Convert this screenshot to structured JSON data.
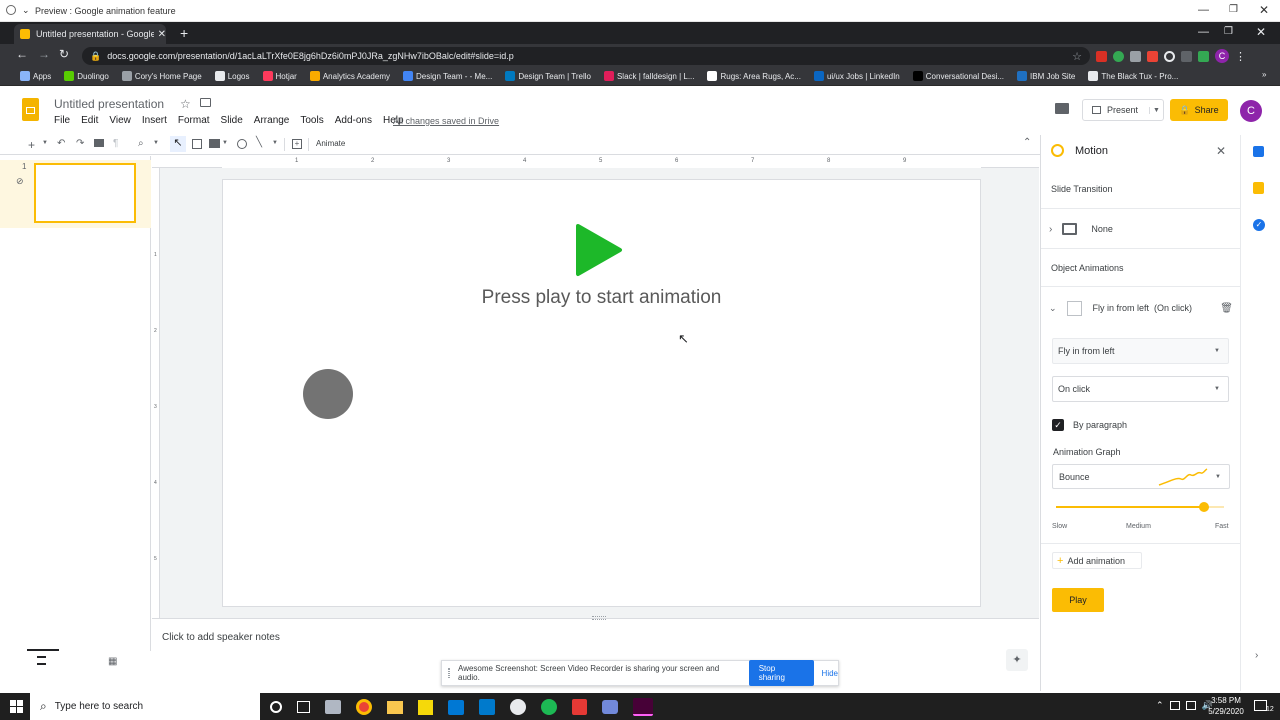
{
  "window": {
    "title": "Preview : Google animation feature"
  },
  "browser": {
    "tab_title": "Untitled presentation - Google S",
    "url": "docs.google.com/presentation/d/1acLaLTrXfe0E8jg6hDz6i0mPJ0JRa_zgNHw7ibOBalc/edit#slide=id.p",
    "profile_initial": "C",
    "bookmarks": [
      {
        "label": "Apps",
        "color": "#8ab4f8"
      },
      {
        "label": "Duolingo",
        "color": "#58cc02"
      },
      {
        "label": "Cory's Home Page",
        "color": "#9aa0a6"
      },
      {
        "label": "Logos",
        "color": "#e8eaed"
      },
      {
        "label": "Hotjar",
        "color": "#fd3a5c"
      },
      {
        "label": "Analytics Academy",
        "color": "#f9ab00"
      },
      {
        "label": "Design Team - - Me...",
        "color": "#4285f4"
      },
      {
        "label": "Design Team | Trello",
        "color": "#0079bf"
      },
      {
        "label": "Slack | falldesign | L...",
        "color": "#e01e5a"
      },
      {
        "label": "Rugs: Area Rugs, Ac...",
        "color": "#ffffff"
      },
      {
        "label": "ui/ux Jobs | LinkedIn",
        "color": "#0a66c2"
      },
      {
        "label": "Conversational Desi...",
        "color": "#000000"
      },
      {
        "label": "IBM Job Site",
        "color": "#1f70c1"
      },
      {
        "label": "The Black Tux - Pro...",
        "color": "#e8eaed"
      }
    ]
  },
  "doc": {
    "title": "Untitled presentation",
    "menus": [
      "File",
      "Edit",
      "View",
      "Insert",
      "Format",
      "Slide",
      "Arrange",
      "Tools",
      "Add-ons",
      "Help"
    ],
    "save_status": "All changes saved in Drive",
    "present_label": "Present",
    "share_label": "Share",
    "avatar": "C",
    "toolbar_animate": "Animate",
    "ruler_numbers": [
      "1",
      "2",
      "3",
      "4",
      "5",
      "6",
      "7",
      "8",
      "9"
    ],
    "vruler_numbers": [
      "1",
      "2",
      "3",
      "4",
      "5"
    ],
    "slide_number": "1",
    "slide_text": "Press play to start animation",
    "notes_placeholder": "Click to add speaker notes"
  },
  "motion": {
    "title": "Motion",
    "slide_transition_heading": "Slide Transition",
    "transition_value": "None",
    "object_animations_heading": "Object Animations",
    "animation_item": "Fly in from left  (On click)",
    "effect_value": "Fly in from left",
    "trigger_value": "On click",
    "by_paragraph_label": "By paragraph",
    "by_paragraph_checked": true,
    "graph_heading": "Animation Graph",
    "graph_value": "Bounce",
    "speed_labels": {
      "slow": "Slow",
      "medium": "Medium",
      "fast": "Fast"
    },
    "speed_level": 0.88,
    "add_animation_label": "Add animation",
    "play_label": "Play"
  },
  "share_bar": {
    "message": "Awesome Screenshot: Screen Video Recorder is sharing your screen and audio.",
    "stop_label": "Stop sharing",
    "hide_label": "Hide"
  },
  "taskbar": {
    "search_placeholder": "Type here to search",
    "time": "3:58 PM",
    "date": "5/29/2020",
    "notifications": "12"
  },
  "colors": {
    "share_yellow": "#fbbc04",
    "play_green": "#1db829",
    "accent_blue": "#1a73e8",
    "avatar_purple": "#8e24aa"
  }
}
